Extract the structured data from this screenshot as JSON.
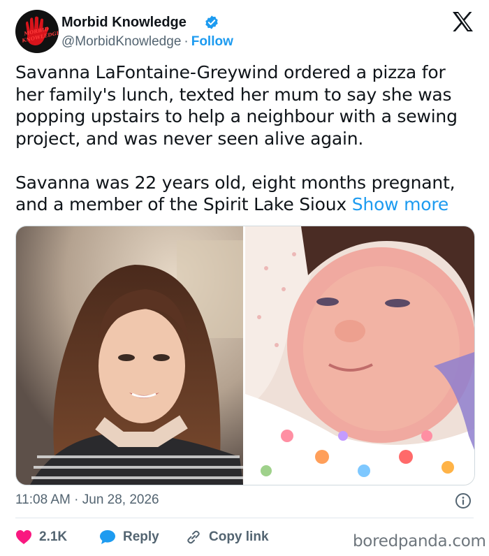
{
  "author": {
    "display_name": "Morbid Knowledge",
    "handle": "@MorbidKnowledge",
    "separator": "·",
    "follow_label": "Follow",
    "avatar_text": "MORBID KNOWLEDGE",
    "verified": true
  },
  "tweet": {
    "paragraph_1": "Savanna LaFontaine-Greywind ordered a pizza for her family's lunch, texted her mum to say she was popping upstairs to help a neighbour with a sewing project, and was never seen alive again.",
    "paragraph_2": "Savanna was 22 years old, eight months pregnant, and a member of the Spirit Lake Sioux",
    "show_more_label": "Show more",
    "timestamp": "11:08 AM · Jun 28, 2026"
  },
  "media": {
    "photos": [
      "woman-portrait",
      "newborn-baby"
    ]
  },
  "actions": {
    "like_count": "2.1K",
    "reply_label": "Reply",
    "copy_link_label": "Copy link"
  },
  "watermark": "boredpanda.com",
  "colors": {
    "accent": "#1d9bf0",
    "like": "#f91880",
    "text": "#0f1419",
    "muted": "#536471"
  },
  "icons": [
    "x-logo-icon",
    "verified-badge-icon",
    "heart-icon",
    "reply-bubble-icon",
    "link-icon",
    "info-icon"
  ]
}
